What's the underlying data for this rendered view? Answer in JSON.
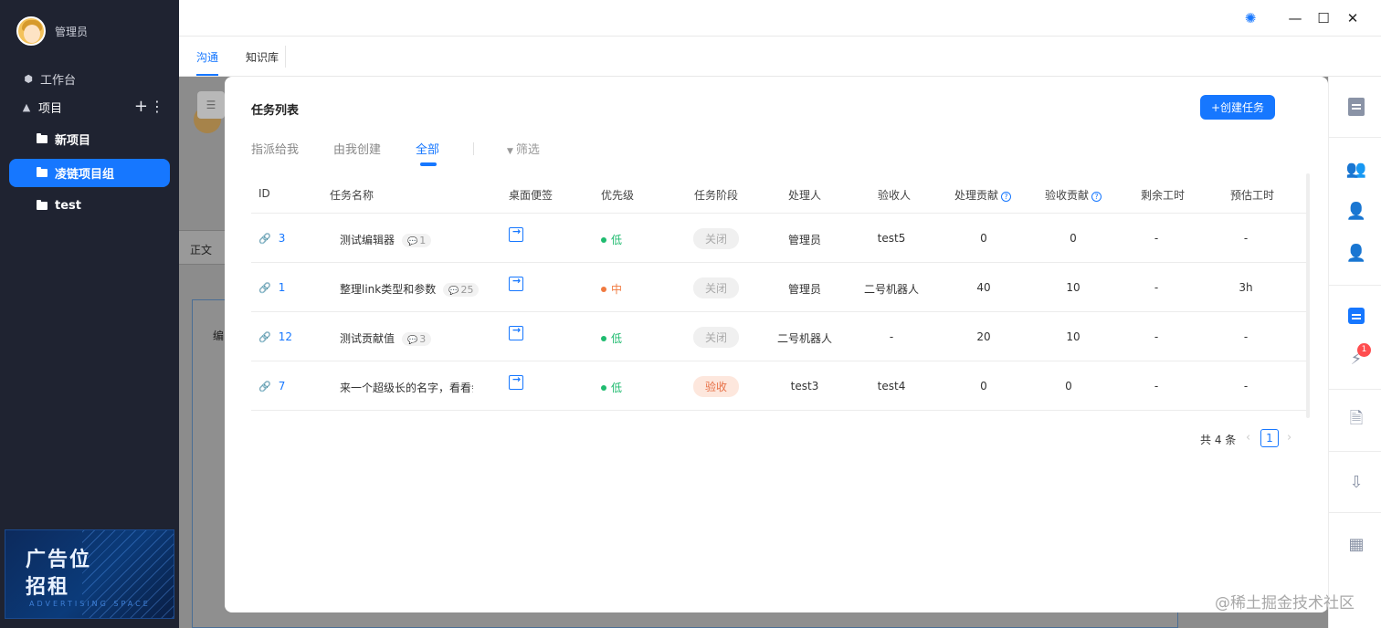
{
  "sidebar": {
    "user_name": "管理员",
    "workbench": "工作台",
    "projects_label": "项目",
    "projects": [
      "新项目",
      "凌链项目组",
      "test"
    ],
    "ad": {
      "line1": "广告位",
      "line2": "招租",
      "line3": "ADVERTISING SPACE"
    }
  },
  "tabs": [
    "沟通",
    "知识库"
  ],
  "background": {
    "label": "正文",
    "doc_text": "编"
  },
  "modal": {
    "title": "任务列表",
    "create_button": "+创建任务",
    "subtabs": [
      "指派给我",
      "由我创建",
      "全部"
    ],
    "filter": "筛选",
    "columns": [
      "ID",
      "任务名称",
      "桌面便签",
      "优先级",
      "任务阶段",
      "处理人",
      "验收人",
      "处理贡献",
      "验收贡献",
      "剩余工时",
      "预估工时"
    ],
    "rows": [
      {
        "id": "3",
        "name": "测试编辑器",
        "comments": "1",
        "priority": "低",
        "priority_color": "#1fbb6f",
        "stage": "关闭",
        "handler": "管理员",
        "acceptor": "test5",
        "handle_contrib": "0",
        "accept_contrib": "0",
        "remaining": "-",
        "estimated": "-"
      },
      {
        "id": "1",
        "name": "整理link类型和参数",
        "comments": "25",
        "priority": "中",
        "priority_color": "#f07a40",
        "stage": "关闭",
        "handler": "管理员",
        "acceptor": "二号机器人",
        "handle_contrib": "40",
        "accept_contrib": "10",
        "remaining": "-",
        "estimated": "3h"
      },
      {
        "id": "12",
        "name": "测试贡献值",
        "comments": "3",
        "priority": "低",
        "priority_color": "#1fbb6f",
        "stage": "关闭",
        "handler": "二号机器人",
        "acceptor": "-",
        "handle_contrib": "20",
        "accept_contrib": "10",
        "remaining": "-",
        "estimated": "-"
      },
      {
        "id": "7",
        "name": "来一个超级长的名字，看看会",
        "comments": "",
        "priority": "低",
        "priority_color": "#1fbb6f",
        "stage": "验收",
        "handler": "test3",
        "acceptor": "test4",
        "handle_contrib": "0",
        "accept_contrib": "0",
        "remaining": "-",
        "estimated": "-"
      }
    ],
    "pager": {
      "total": "共 4 条",
      "current": "1"
    }
  },
  "watermark": "@稀土掘金技术社区"
}
